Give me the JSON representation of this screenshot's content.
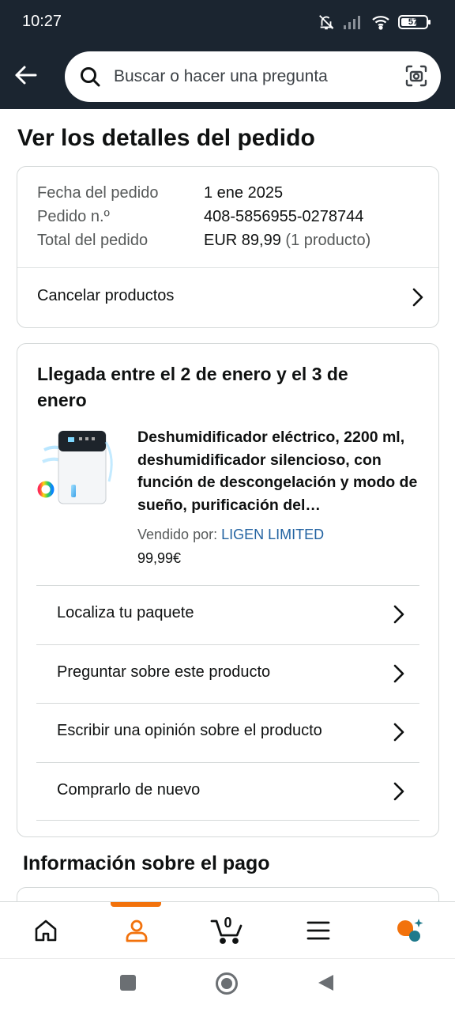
{
  "status_bar": {
    "time": "10:27",
    "battery": "57"
  },
  "header": {
    "search_placeholder": "Buscar o hacer una pregunta"
  },
  "page": {
    "title": "Ver los detalles del pedido"
  },
  "order_summary": {
    "date_label": "Fecha del pedido",
    "date_value": "1 ene 2025",
    "number_label": "Pedido n.º",
    "number_value": "408-5856955-0278744",
    "total_label": "Total del pedido",
    "total_value": "EUR 89,99",
    "total_count": "(1 producto)",
    "cancel_label": "Cancelar productos"
  },
  "delivery": {
    "title": "Llegada entre el 2 de enero y el 3 de enero",
    "product_title": "Deshumidificador eléctrico, 2200 ml, deshumidificador silencioso, con función de descongelación y modo de sueño, purificación del…",
    "seller_label": "Vendido por:",
    "seller_name": "LIGEN LIMITED",
    "price": "99,99€",
    "actions": [
      {
        "label": "Localiza tu paquete"
      },
      {
        "label": "Preguntar sobre este producto"
      },
      {
        "label": "Escribir una opinión sobre el producto"
      },
      {
        "label": "Comprarlo de nuevo"
      }
    ]
  },
  "payment": {
    "title": "Información sobre el pago"
  },
  "bottom_nav": {
    "cart_count": "0",
    "active": "account",
    "accent_color": "#f2720c"
  },
  "icons": [
    "back-arrow-icon",
    "search-icon",
    "camera-icon",
    "chevron-right-icon",
    "home-icon",
    "person-icon",
    "cart-icon",
    "menu-icon",
    "chat-assistant-icon"
  ]
}
